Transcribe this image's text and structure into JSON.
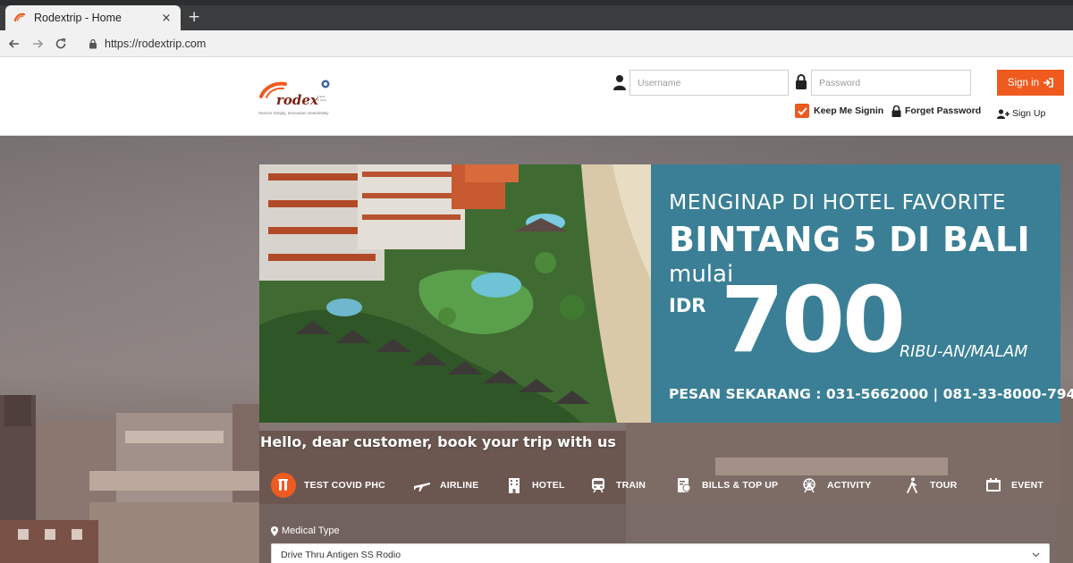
{
  "browser": {
    "tab_title": "Rodextrip - Home",
    "tab_close": "×",
    "new_tab": "+",
    "url": "https://rodextrip.com"
  },
  "header": {
    "logo_text": "rodex",
    "logo_tagline": "Service Simply, Innovation Seamlessly",
    "username_placeholder": "Username",
    "password_placeholder": "Password",
    "signin_label": "Sign in",
    "keep_signin_label": "Keep Me Signin",
    "keep_signin_checked": true,
    "forget_password_label": "Forget Password",
    "signup_label": "Sign Up"
  },
  "banner": {
    "line1": "MENGINAP DI HOTEL FAVORITE",
    "line2": "BINTANG 5 DI BALI",
    "line3": "mulai",
    "currency": "IDR",
    "price": "700",
    "unit": "RIBU-AN/MALAM",
    "contact": "PESAN SEKARANG : 031-5662000 | 081-33-8000-794"
  },
  "greeting": "Hello, dear customer, book your trip with us",
  "services": [
    {
      "label": "TEST COVID PHC",
      "icon": "test-tube-icon",
      "active": true
    },
    {
      "label": "AIRLINE",
      "icon": "airplane-icon"
    },
    {
      "label": "HOTEL",
      "icon": "hotel-icon"
    },
    {
      "label": "TRAIN",
      "icon": "train-icon"
    },
    {
      "label": "BILLS & TOP UP",
      "icon": "bills-icon"
    },
    {
      "label": "ACTIVITY",
      "icon": "ferris-wheel-icon"
    },
    {
      "label": "TOUR",
      "icon": "hiker-icon"
    },
    {
      "label": "EVENT",
      "icon": "event-ticket-icon"
    }
  ],
  "form": {
    "medical_type_label": "Medical Type",
    "medical_type_value": "Drive Thru Antigen SS Rodio"
  },
  "colors": {
    "accent": "#ef5a1f",
    "banner_panel": "#3a7f95"
  }
}
